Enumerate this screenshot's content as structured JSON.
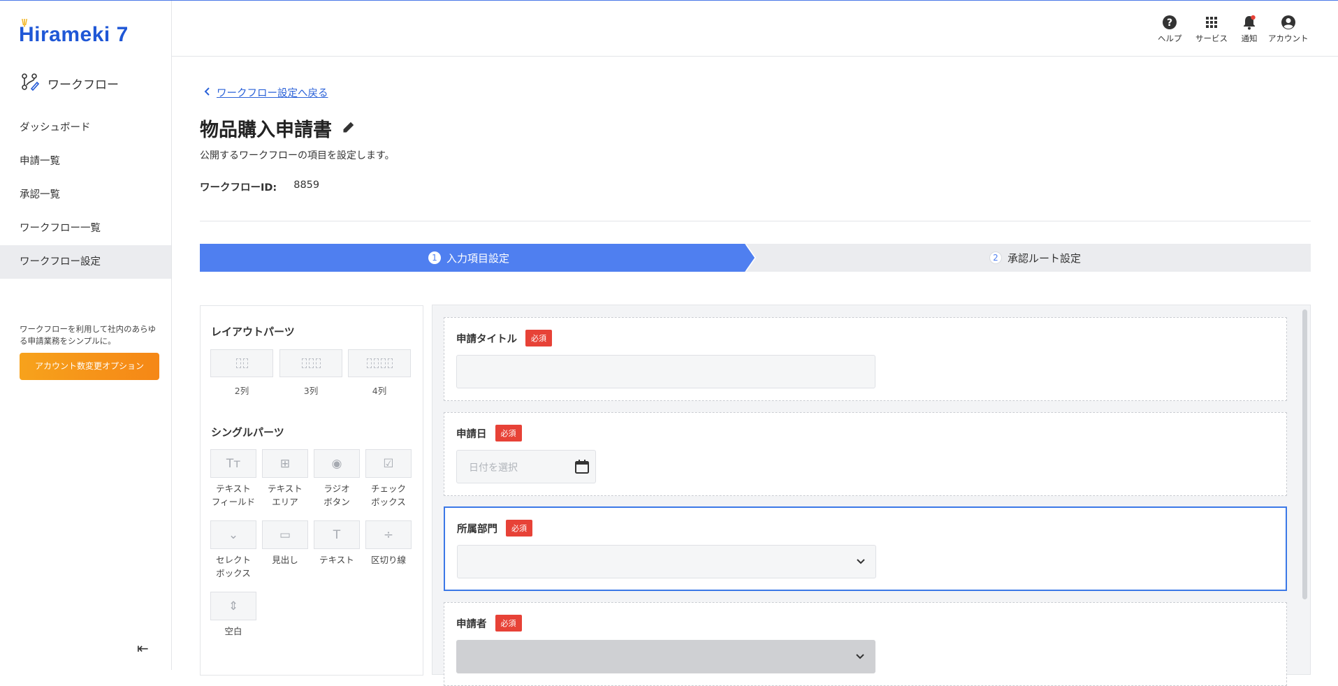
{
  "app": {
    "logo": "Hirameki 7",
    "logo_spark": "\\|/",
    "module_name": "ワークフロー"
  },
  "header": {
    "icons": [
      {
        "name": "help",
        "label": "ヘルプ"
      },
      {
        "name": "services",
        "label": "サービス"
      },
      {
        "name": "notifications",
        "label": "通知"
      },
      {
        "name": "account",
        "label": "アカウント"
      }
    ]
  },
  "sidebar": {
    "items": [
      {
        "label": "ダッシュボード"
      },
      {
        "label": "申請一覧"
      },
      {
        "label": "承認一覧"
      },
      {
        "label": "ワークフロー一覧"
      },
      {
        "label": "ワークフロー設定",
        "active": true
      }
    ],
    "promo_text": "ワークフローを利用して社内のあらゆる申請業務をシンプルに。",
    "promo_button": "アカウント数変更オプション",
    "collapse_icon": "⇤"
  },
  "page": {
    "back_link": "ワークフロー設定へ戻る",
    "title": "物品購入申請書",
    "subtitle": "公開するワークフローの項目を設定します。",
    "workflow_id_label": "ワークフローID:",
    "workflow_id_value": "8859"
  },
  "steps": [
    {
      "num": "1",
      "label": "入力項目設定",
      "active": true
    },
    {
      "num": "2",
      "label": "承認ルート設定",
      "active": false
    }
  ],
  "palette": {
    "layout_heading": "レイアウトパーツ",
    "layout_parts": [
      {
        "label": "2列",
        "cols": 2
      },
      {
        "label": "3列",
        "cols": 3
      },
      {
        "label": "4列",
        "cols": 4
      }
    ],
    "single_heading": "シングルパーツ",
    "single_parts": [
      {
        "label1": "テキスト",
        "label2": "フィールド",
        "icon": "Tт"
      },
      {
        "label1": "テキスト",
        "label2": "エリア",
        "icon": "⊞"
      },
      {
        "label1": "ラジオ",
        "label2": "ボタン",
        "icon": "◉"
      },
      {
        "label1": "チェック",
        "label2": "ボックス",
        "icon": "☑"
      },
      {
        "label1": "セレクト",
        "label2": "ボックス",
        "icon": "⌄"
      },
      {
        "label1": "見出し",
        "label2": "",
        "icon": "▭"
      },
      {
        "label1": "テキスト",
        "label2": "",
        "icon": "T"
      },
      {
        "label1": "区切り線",
        "label2": "",
        "icon": "÷"
      },
      {
        "label1": "空白",
        "label2": "",
        "icon": "⇕"
      }
    ]
  },
  "form": {
    "required_badge": "必須",
    "fields": [
      {
        "label": "申請タイトル",
        "type": "text"
      },
      {
        "label": "申請日",
        "type": "date",
        "placeholder": "日付を選択"
      },
      {
        "label": "所属部門",
        "type": "select",
        "selected": true
      },
      {
        "label": "申請者",
        "type": "select",
        "disabled": true
      }
    ]
  }
}
